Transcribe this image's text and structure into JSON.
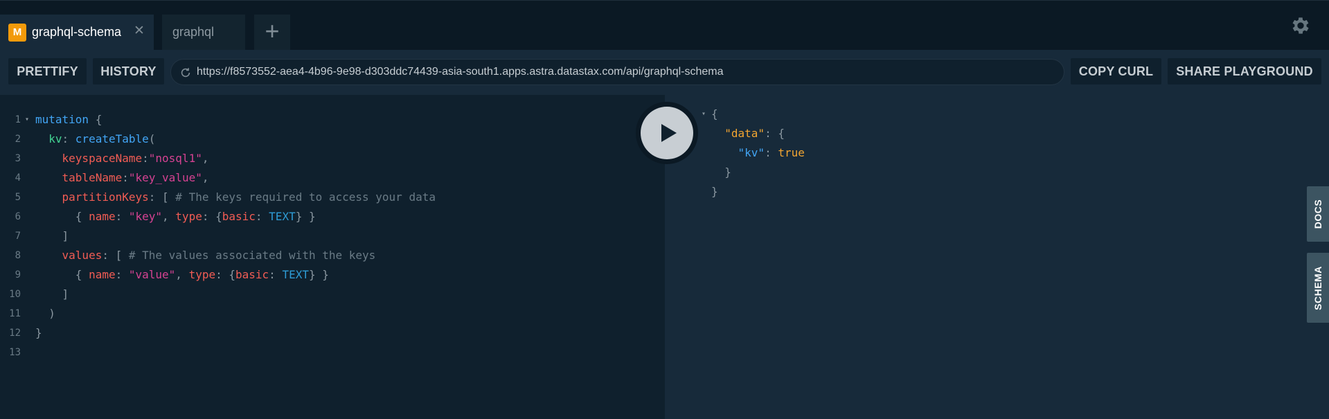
{
  "tabs": [
    {
      "badge": "M",
      "title": "graphql-schema",
      "close": "✕"
    },
    {
      "title": "graphql"
    }
  ],
  "tab_add_label": "+",
  "toolbar": {
    "prettify": "PRETTIFY",
    "history": "HISTORY",
    "url": "https://f8573552-aea4-4b96-9e98-d303ddc74439-asia-south1.apps.astra.datastax.com/api/graphql-schema",
    "copy_curl": "COPY CURL",
    "share": "SHARE PLAYGROUND"
  },
  "query_lines": [
    {
      "n": "1",
      "fold": true,
      "tokens": [
        [
          "kw",
          "mutation"
        ],
        [
          "p",
          " {"
        ]
      ]
    },
    {
      "n": "2",
      "tokens": [
        [
          "p",
          "  "
        ],
        [
          "alias",
          "kv"
        ],
        [
          "p",
          ": "
        ],
        [
          "field",
          "createTable"
        ],
        [
          "p",
          "("
        ]
      ]
    },
    {
      "n": "3",
      "tokens": [
        [
          "p",
          "    "
        ],
        [
          "arg",
          "keyspaceName"
        ],
        [
          "p",
          ":"
        ],
        [
          "str",
          "\"nosql1\""
        ],
        [
          "p",
          ","
        ]
      ]
    },
    {
      "n": "4",
      "tokens": [
        [
          "p",
          "    "
        ],
        [
          "arg",
          "tableName"
        ],
        [
          "p",
          ":"
        ],
        [
          "str",
          "\"key_value\""
        ],
        [
          "p",
          ","
        ]
      ]
    },
    {
      "n": "5",
      "tokens": [
        [
          "p",
          "    "
        ],
        [
          "arg",
          "partitionKeys"
        ],
        [
          "p",
          ": [ "
        ],
        [
          "cmt",
          "# The keys required to access your data"
        ]
      ]
    },
    {
      "n": "6",
      "tokens": [
        [
          "p",
          "      { "
        ],
        [
          "arg",
          "name"
        ],
        [
          "p",
          ": "
        ],
        [
          "str",
          "\"key\""
        ],
        [
          "p",
          ", "
        ],
        [
          "arg",
          "type"
        ],
        [
          "p",
          ": {"
        ],
        [
          "arg",
          "basic"
        ],
        [
          "p",
          ": "
        ],
        [
          "enum",
          "TEXT"
        ],
        [
          "p",
          "} }"
        ]
      ]
    },
    {
      "n": "7",
      "tokens": [
        [
          "p",
          "    ]"
        ]
      ]
    },
    {
      "n": "8",
      "tokens": [
        [
          "p",
          "    "
        ],
        [
          "arg",
          "values"
        ],
        [
          "p",
          ": [ "
        ],
        [
          "cmt",
          "# The values associated with the keys"
        ]
      ]
    },
    {
      "n": "9",
      "tokens": [
        [
          "p",
          "      { "
        ],
        [
          "arg",
          "name"
        ],
        [
          "p",
          ": "
        ],
        [
          "str",
          "\"value\""
        ],
        [
          "p",
          ", "
        ],
        [
          "arg",
          "type"
        ],
        [
          "p",
          ": {"
        ],
        [
          "arg",
          "basic"
        ],
        [
          "p",
          ": "
        ],
        [
          "enum",
          "TEXT"
        ],
        [
          "p",
          "} }"
        ]
      ]
    },
    {
      "n": "10",
      "tokens": [
        [
          "p",
          "    ]"
        ]
      ]
    },
    {
      "n": "11",
      "tokens": [
        [
          "p",
          "  )"
        ]
      ]
    },
    {
      "n": "12",
      "tokens": [
        [
          "p",
          "}"
        ]
      ]
    },
    {
      "n": "13",
      "tokens": []
    }
  ],
  "result_lines": [
    {
      "fold": true,
      "tokens": [
        [
          "p",
          "{"
        ]
      ]
    },
    {
      "tokens": [
        [
          "p",
          "  "
        ],
        [
          "key-data",
          "\"data\""
        ],
        [
          "p",
          ": {"
        ]
      ]
    },
    {
      "tokens": [
        [
          "p",
          "    "
        ],
        [
          "key-kv",
          "\"kv\""
        ],
        [
          "p",
          ": "
        ],
        [
          "bool",
          "true"
        ]
      ]
    },
    {
      "tokens": [
        [
          "p",
          "  }"
        ]
      ]
    },
    {
      "tokens": [
        [
          "p",
          "}"
        ]
      ]
    }
  ],
  "side_tabs": {
    "docs": "DOCS",
    "schema": "SCHEMA"
  },
  "icons": {
    "settings": "gear-icon",
    "reload": "reload-icon",
    "run": "play-icon",
    "fold": "fold-arrow-icon"
  }
}
